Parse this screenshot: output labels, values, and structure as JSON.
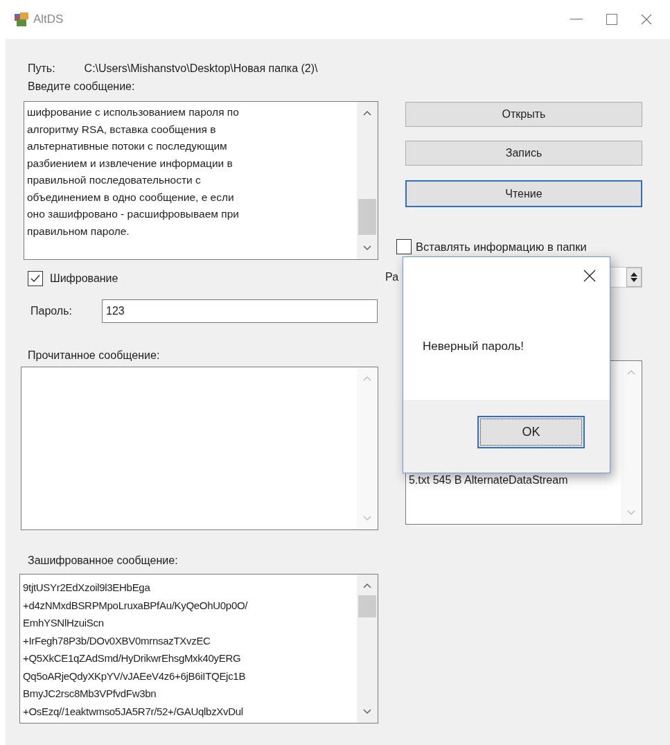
{
  "window": {
    "title": "AltDS"
  },
  "path": {
    "label": "Путь:",
    "value": "C:\\Users\\Mishanstvo\\Desktop\\Новая папка (2)\\"
  },
  "message": {
    "label": "Введите сообщение:",
    "lines": [
      "шифрование с использованием пароля по",
      "алгоритму RSA, вставка сообщения в",
      "альтернативные потоки с последующим",
      "разбиением и извлечение информации в",
      "правильной последовательности с",
      "объединением в одно сообщение, е если",
      "оно зашифровано - расшифровываем при",
      "правильном пароле."
    ]
  },
  "buttons": [
    {
      "label": "Открыть",
      "focused": false
    },
    {
      "label": "Запись",
      "focused": false
    },
    {
      "label": "Чтение",
      "focused": true
    }
  ],
  "insert_into_folders": {
    "label": "Вставлять информацию в папки",
    "checked": false
  },
  "encryption": {
    "label": "Шифрование",
    "checked": true
  },
  "password": {
    "label": "Пароль:",
    "value": "123"
  },
  "parts_label": "Ра",
  "read_message": {
    "label": "Прочитанное сообщение:"
  },
  "streams": {
    "items": [
      "5.txt 545 B AlternateDataStream"
    ]
  },
  "encrypted_message": {
    "label": "Зашифрованное сообщение:",
    "lines": [
      "9tjtUSYr2EdXzoil9l3EHbEga",
      "+d4zNMxdBSRPMpoLruxaBPfAu/KyQeOhU0p0O/",
      "EmhYSNlHzuiScn",
      "+IrFegh78P3b/DOv0XBV0mrnsazTXvzEC",
      "+Q5XkCE1qZAdSmd/HyDrikwrEhsgMxk40yERG",
      "Qq5oARjeQdyXKpYV/vJAEeV4z6+6jB6iITQEjc1B",
      "BmyJC2rsc8Mb3VPfvdFw3bn",
      "+OsEzq//1eaktwmso5JA5R7r/52+/GAUqlbzXvDul"
    ]
  },
  "dialog": {
    "message": "Неверный пароль!",
    "button": "OK"
  }
}
